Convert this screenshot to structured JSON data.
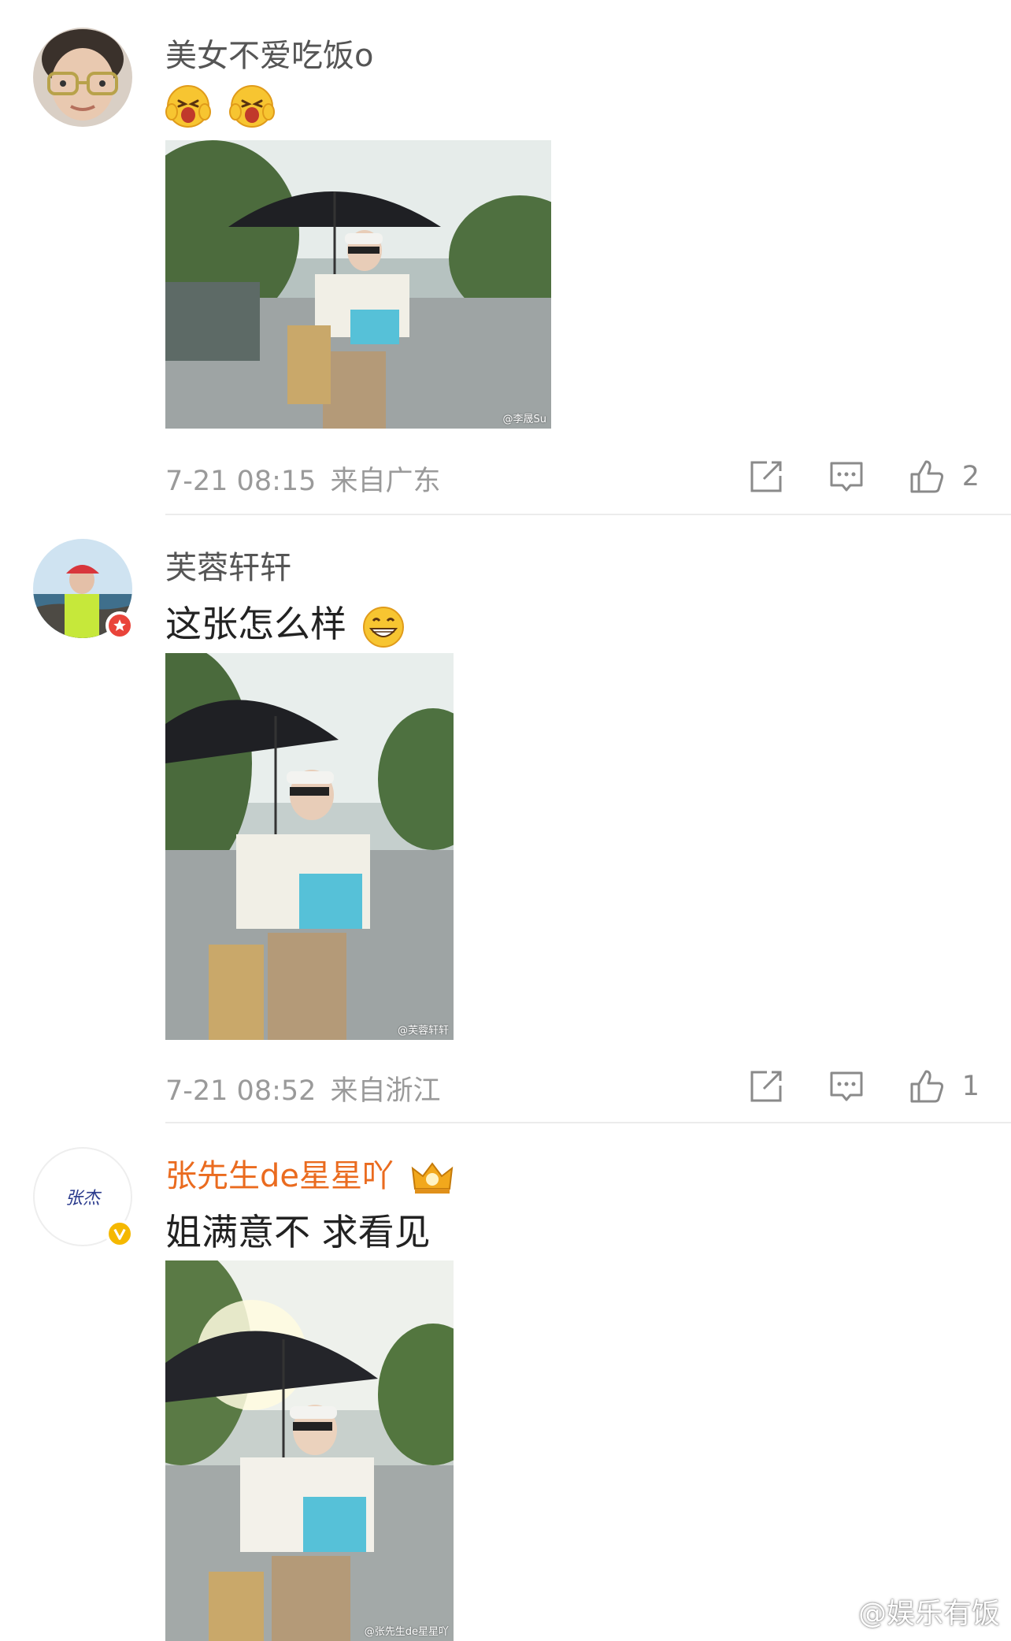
{
  "comments": [
    {
      "username": "美女不爱吃饭o",
      "text": "",
      "emojis": [
        "laughing-face-emoji",
        "laughing-face-emoji"
      ],
      "photo_watermark": "@李晟Su",
      "time": "7-21 08:15",
      "source": "来自广东",
      "like_count": "2"
    },
    {
      "username": "芙蓉轩轩",
      "text": "这张怎么样",
      "emojis": [
        "grinning-face-emoji"
      ],
      "photo_watermark": "@芙蓉轩轩",
      "time": "7-21 08:52",
      "source": "来自浙江",
      "like_count": "1"
    },
    {
      "username": "张先生de星星吖",
      "text": "姐满意不  求看见",
      "avatar_text": "张杰",
      "photo_watermark": "@张先生de星星吖",
      "badges": [
        "crown-vip-icon",
        "verified-v-icon"
      ]
    }
  ],
  "footer_watermark": "@娱乐有饭",
  "colors": {
    "vip_name": "#ea6b1f",
    "meta_text": "#9a9a9a",
    "verified_badge": "#f5b800",
    "red_badge": "#e9443a"
  }
}
